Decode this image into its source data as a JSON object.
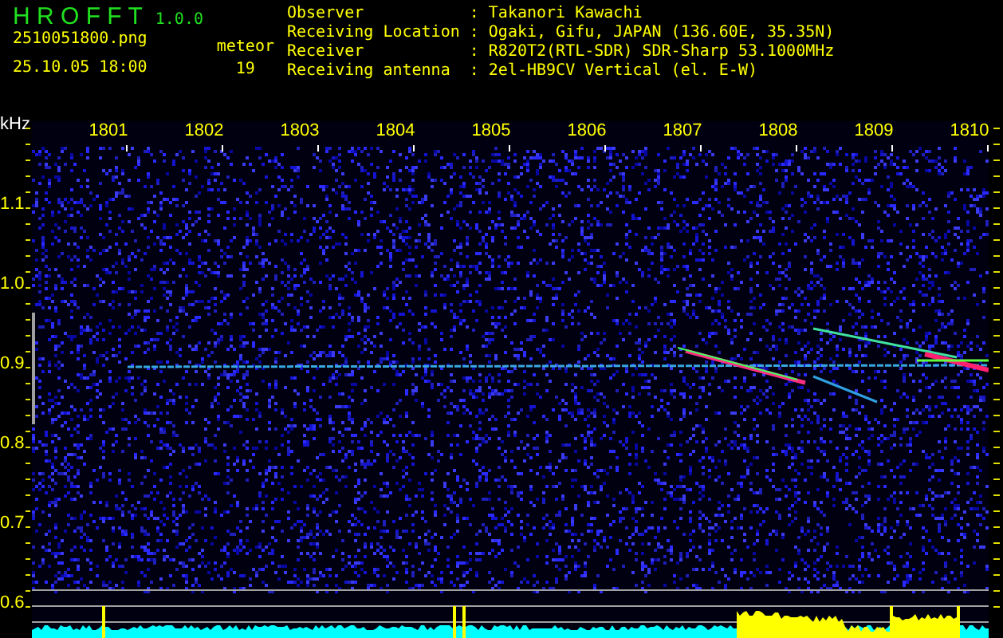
{
  "app": {
    "name": "H R O F F T",
    "version": "1.0.0",
    "filename": "2510051800.png",
    "timestamp": "25.10.05 18:00",
    "count_label": "meteor",
    "count": "19"
  },
  "station_info": [
    {
      "label": "Observer",
      "separator": ":",
      "value": "Takanori Kawachi"
    },
    {
      "label": "Receiving Location",
      "separator": ":",
      "value": "Ogaki, Gifu, JAPAN (136.60E, 35.35N)"
    },
    {
      "label": "Receiver",
      "separator": ":",
      "value": "R820T2(RTL-SDR) SDR-Sharp 53.1000MHz"
    },
    {
      "label": "Receiving antenna",
      "separator": ":",
      "value": "2el-HB9CV Vertical (el. E-W)"
    }
  ],
  "plot": {
    "y_unit": "kHz",
    "y_labels": [
      "1.1",
      "1.0",
      "0.9",
      "0.8",
      "0.7",
      "0.6"
    ],
    "x_labels": [
      "1801",
      "1802",
      "1803",
      "1804",
      "1805",
      "1806",
      "1807",
      "1808",
      "1809",
      "1810"
    ]
  }
}
